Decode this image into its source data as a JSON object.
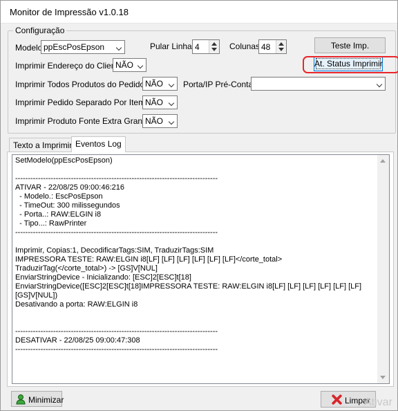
{
  "window": {
    "title": "Monitor de Impressão v1.0.18"
  },
  "config": {
    "legend": "Configuração",
    "modelo_label": "Modelo",
    "modelo_value": "ppEscPosEpson",
    "pular_linhas_label": "Pular Linhas",
    "pular_linhas_value": "4",
    "colunas_label": "Colunas",
    "colunas_value": "48",
    "teste_button": "Teste Imp.",
    "status_button": "At. Status Imprimir",
    "endereco_label": "Imprimir Endereço do Cliente",
    "endereco_value": "NÃO",
    "todos_produtos_label": "Imprimir Todos Produtos do Pedido",
    "todos_produtos_value": "NÃO",
    "porta_label": "Porta/IP Pré-Conta",
    "porta_value": "",
    "separado_label": "Imprimir Pedido Separado Por Item",
    "separado_value": "NÃO",
    "fonte_label": "Imprimir Produto Fonte Extra Grande",
    "fonte_value": "NÃO"
  },
  "tabs": [
    "Texto a Imprimir",
    "Eventos Log"
  ],
  "active_tab": "Eventos Log",
  "log_lines": [
    "SetModelo(ppEscPosEpson)",
    "",
    "--------------------------------------------------------------------------------",
    "ATIVAR - 22/08/25 09:00:46:216",
    "  - Modelo.: EscPosEpson",
    "  - TimeOut: 300 milissegundos",
    "  - Porta..: RAW:ELGIN i8",
    "  - Tipo...: RawPrinter",
    "--------------------------------------------------------------------------------",
    "",
    "Imprimir, Copias:1, DecodificarTags:SIM, TraduzirTags:SIM",
    "IMPRESSORA TESTE: RAW:ELGIN i8[LF] [LF] [LF] [LF] [LF] [LF]</corte_total>",
    "TraduzirTag(</corte_total>) -> [GS]V[NUL]",
    "EnviarStringDevice - Inicializando: [ESC]2[ESC]t[18]",
    "EnviarStringDevice([ESC]2[ESC]t[18]IMPRESSORA TESTE: RAW:ELGIN i8[LF] [LF] [LF] [LF] [LF] [LF][GS]V[NUL])",
    "Desativando a porta: RAW:ELGIN i8",
    "",
    "",
    "--------------------------------------------------------------------------------",
    "DESATIVAR - 22/08/25 09:00:47:308",
    "--------------------------------------------------------------------------------"
  ],
  "footer": {
    "minimizar": "Minimizar",
    "limpar": "Limpar",
    "watermark": "Ativar"
  },
  "colors": {
    "highlight": "#e8262b",
    "focus": "#0078d7"
  }
}
